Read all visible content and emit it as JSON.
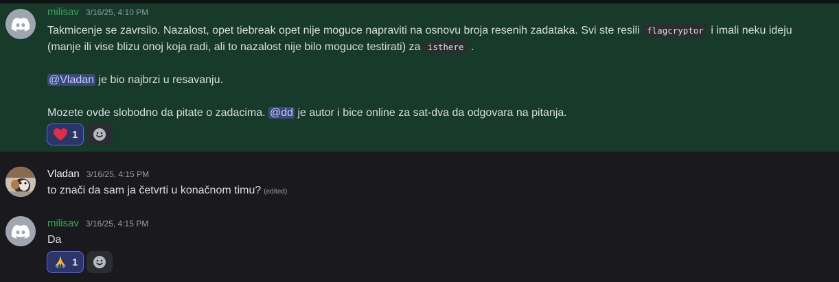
{
  "messages": [
    {
      "username": "milisav",
      "timestamp": "3/16/25, 4:10 PM",
      "line1_pre": "Takmicenje se zavrsilo. Nazalost, opet tiebreak opet nije moguce napraviti na osnovu broja resenih zadataka. Svi ste resili ",
      "code1": "flagcryptor",
      "line1_post": " i imali neku ideju",
      "line2_pre": "(manje ili vise blizu onoj koja radi, ali to nazalost nije bilo moguce testirati) za ",
      "code2": "isthere",
      "line2_post": " .",
      "mention1": "@Vladan",
      "line3_post": " je bio najbrzi u resavanju.",
      "line4_pre": "Mozete ovde slobodno da pitate o zadacima. ",
      "mention2": "@dd",
      "line4_post": " je autor i bice online za sat-dva da odgovara na pitanja.",
      "reaction": {
        "emoji": "heart-emoji",
        "count": "1"
      }
    },
    {
      "username": "Vladan",
      "timestamp": "3/16/25, 4:15 PM",
      "text": "to znači da sam ja četvrti u konačnom timu?",
      "edited": "(edited)"
    },
    {
      "username": "milisav",
      "timestamp": "3/16/25, 4:15 PM",
      "text": "Da",
      "reaction": {
        "emoji": "folded-hands-emoji",
        "count": "1"
      }
    }
  ],
  "colors": {
    "background": "#1a1a1e",
    "highlight": "#173a2b",
    "username_green": "#3ba55d",
    "mention_bg": "#3b4978",
    "reaction_border": "#5865f2"
  }
}
